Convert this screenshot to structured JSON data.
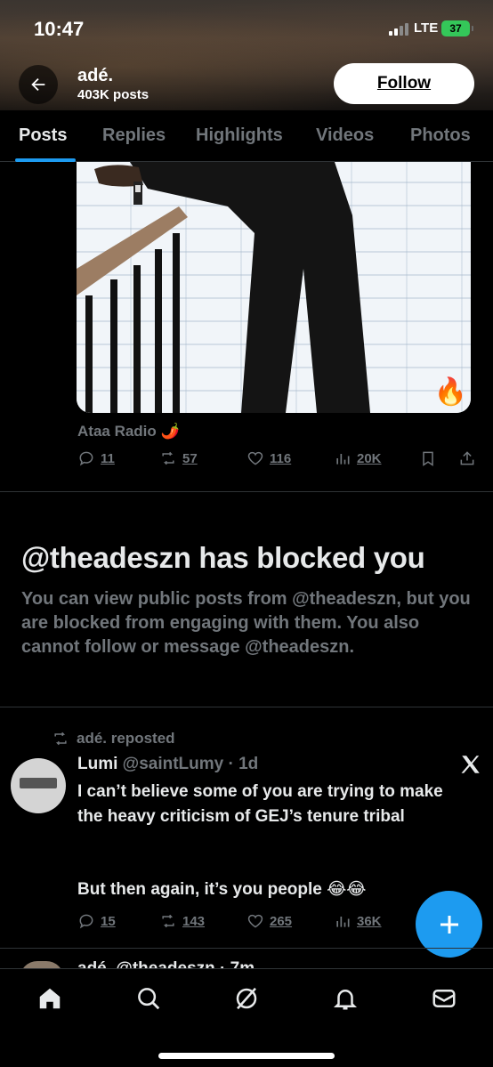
{
  "status_bar": {
    "time": "10:47",
    "network": "LTE",
    "battery": "37"
  },
  "header": {
    "name": "adé.",
    "post_count": "403K posts",
    "follow_label": "Follow"
  },
  "tabs": [
    {
      "label": "Posts",
      "active": true
    },
    {
      "label": "Replies",
      "active": false
    },
    {
      "label": "Highlights",
      "active": false
    },
    {
      "label": "Videos",
      "active": false
    },
    {
      "label": "Photos",
      "active": false
    }
  ],
  "post1": {
    "source_label": "Ataa Radio 🌶️",
    "badge_emoji": "🔥",
    "replies": "11",
    "reposts": "57",
    "likes": "116",
    "views": "20K"
  },
  "blocked": {
    "title": "@theadeszn has blocked you",
    "body": "You can view public posts from @theadeszn, but you are blocked from engaging with them. You also cannot follow or message @theadeszn."
  },
  "post2": {
    "repost_label": "adé. reposted",
    "author_name": "Lumi",
    "author_handle": "@saintLumy · 1d",
    "text_line1": "I can’t believe some of you are trying to make the heavy criticism of GEJ’s tenure tribal",
    "text_line2": "But then again, it’s you people 😂😂",
    "replies": "15",
    "reposts": "143",
    "likes": "265",
    "views": "36K"
  },
  "post3": {
    "partial_line": "adé. @theadeszn · 7m"
  },
  "colors": {
    "accent": "#1d9bf0",
    "muted": "#71767b",
    "text": "#e7e9ea",
    "divider": "#2f3336"
  },
  "icons": [
    "arrow-left-icon",
    "reply-icon",
    "repost-icon",
    "like-icon",
    "views-icon",
    "bookmark-icon",
    "share-icon",
    "x-logo-icon",
    "plus-icon",
    "home-icon",
    "search-icon",
    "grok-icon",
    "bell-icon",
    "mail-icon"
  ]
}
